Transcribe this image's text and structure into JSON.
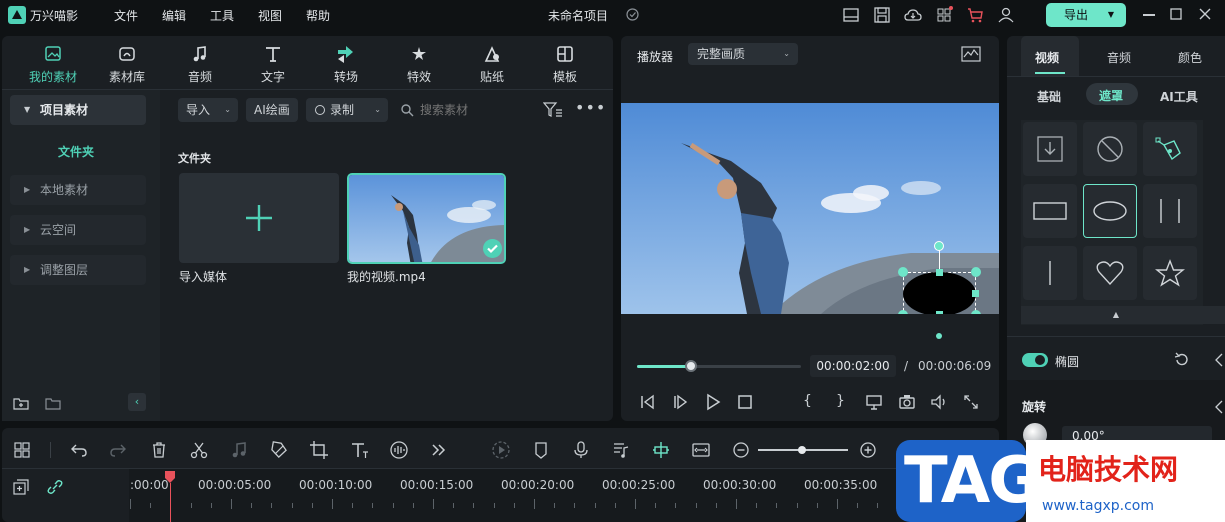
{
  "app": {
    "name": "万兴喵影",
    "project_title": "未命名项目",
    "export_label": "导出"
  },
  "menu": [
    "文件",
    "编辑",
    "工具",
    "视图",
    "帮助"
  ],
  "media_tabs": [
    {
      "label": "我的素材",
      "icon": "media-icon"
    },
    {
      "label": "素材库",
      "icon": "library-icon"
    },
    {
      "label": "音频",
      "icon": "music-icon"
    },
    {
      "label": "文字",
      "icon": "text-icon"
    },
    {
      "label": "转场",
      "icon": "transition-icon"
    },
    {
      "label": "特效",
      "icon": "effects-icon"
    },
    {
      "label": "贴纸",
      "icon": "sticker-icon"
    },
    {
      "label": "模板",
      "icon": "template-icon"
    }
  ],
  "sidebar": {
    "project_media": "项目素材",
    "folder": "文件夹",
    "items": [
      "本地素材",
      "云空间",
      "调整图层"
    ]
  },
  "toolbar": {
    "import": "导入",
    "ai_paint": "AI绘画",
    "record": "录制",
    "search_placeholder": "搜索素材"
  },
  "library": {
    "section": "文件夹",
    "import_media": "导入媒体",
    "clip_name": "我的视频.mp4"
  },
  "player": {
    "label": "播放器",
    "quality": "完整画质",
    "current_time": "00:00:02:00",
    "separator": "/",
    "total_time": "00:00:06:09",
    "progress": 0.33
  },
  "inspector": {
    "tabs": [
      "视频",
      "音频",
      "颜色"
    ],
    "subtabs": [
      "基础",
      "遮罩",
      "AI工具"
    ],
    "mask_label": "椭圆",
    "rotate_label": "旋转",
    "rotate_value": "0.00°"
  },
  "timeline": {
    "ticks": [
      ":00:00",
      "00:00:05:00",
      "00:00:10:00",
      "00:00:15:00",
      "00:00:20:00",
      "00:00:25:00",
      "00:00:30:00",
      "00:00:35:00"
    ]
  },
  "watermark": {
    "tag": "TAG",
    "site_name": "电脑技术网",
    "url": "www.tagxp.com"
  },
  "colors": {
    "accent": "#4fd1b6",
    "bg": "#0f1214",
    "panel": "#1b1f23",
    "playhead": "#e8525b"
  }
}
